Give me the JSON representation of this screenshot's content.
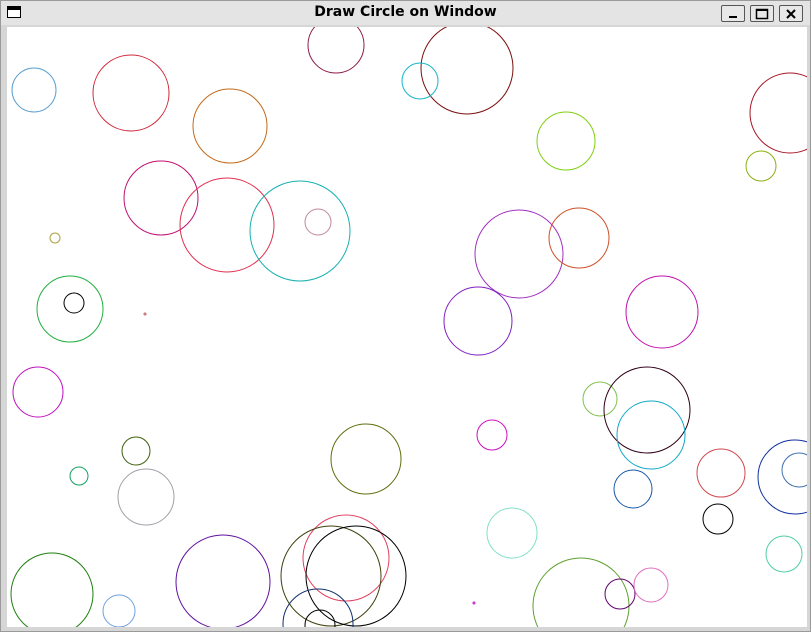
{
  "window": {
    "title": "Draw Circle on Window"
  },
  "controls": {
    "minimize_icon": "minimize-icon",
    "maximize_icon": "maximize-icon",
    "close_icon": "close-icon"
  },
  "canvas": {
    "background": "#ffffff"
  }
}
